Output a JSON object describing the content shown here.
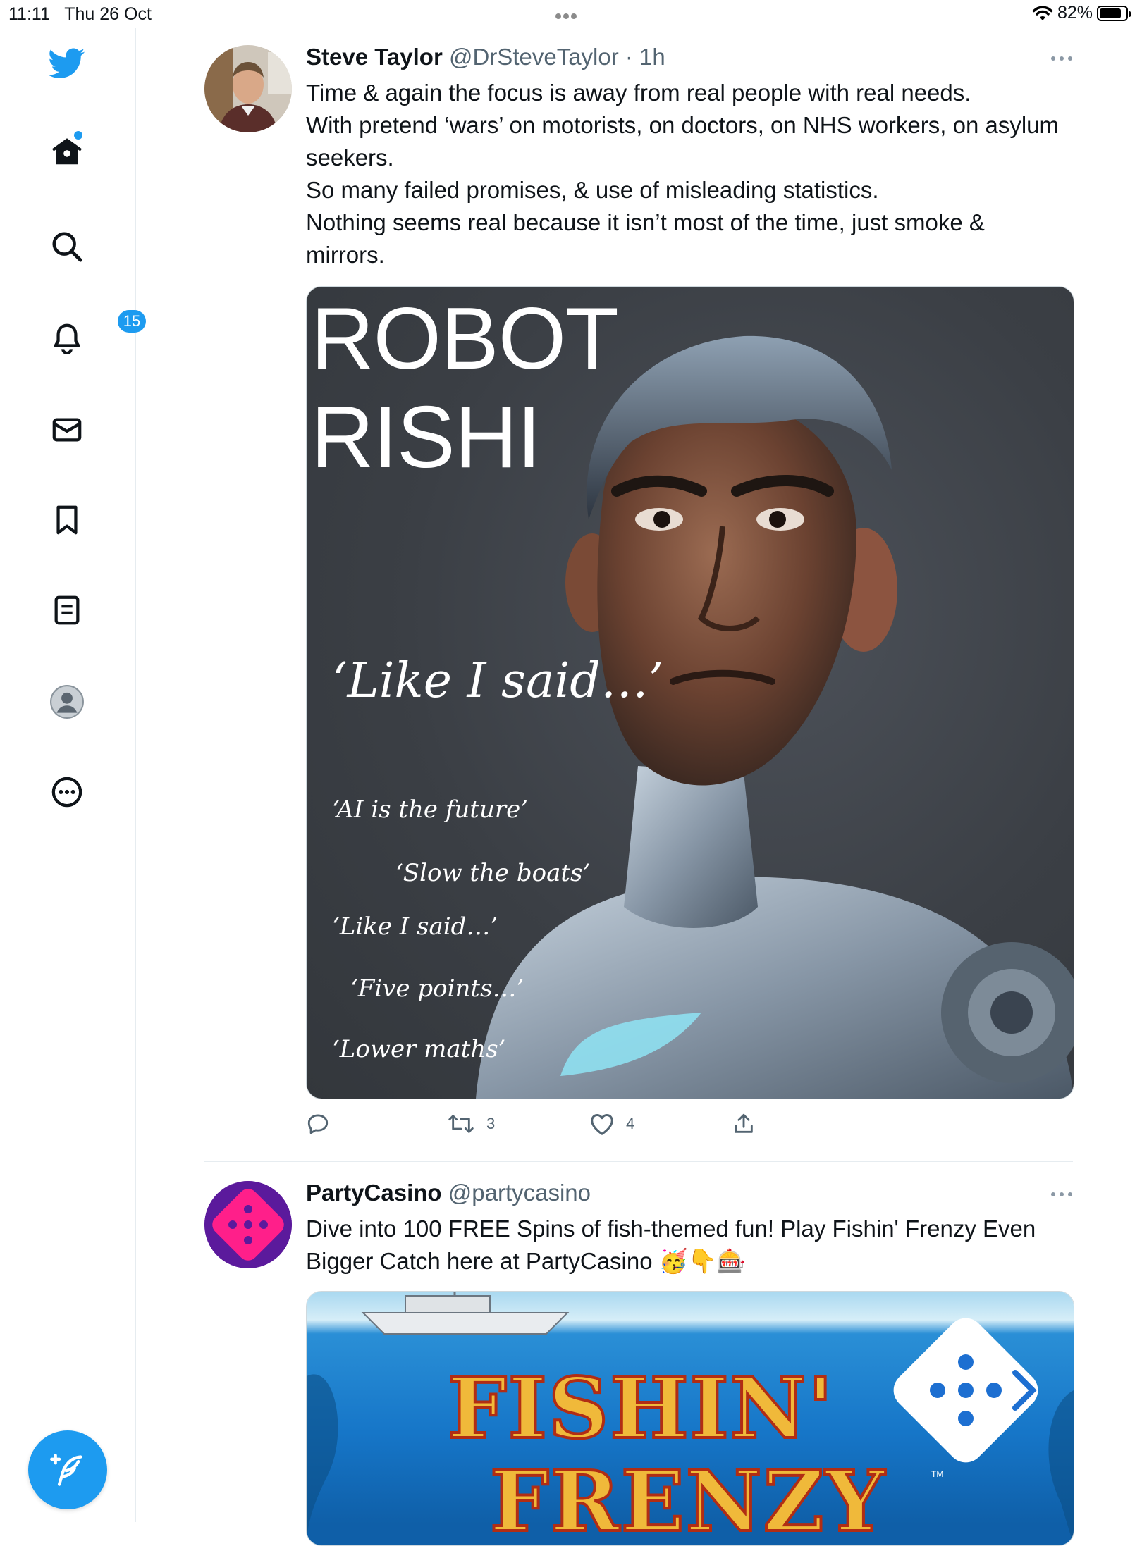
{
  "status_bar": {
    "time": "11:11",
    "date": "Thu 26 Oct",
    "battery": "82%",
    "battery_level": 0.82
  },
  "sidebar": {
    "items": [
      {
        "name": "twitter-logo"
      },
      {
        "name": "home",
        "has_unread": true
      },
      {
        "name": "search"
      },
      {
        "name": "notifications",
        "badge": "15"
      },
      {
        "name": "messages"
      },
      {
        "name": "bookmarks"
      },
      {
        "name": "lists"
      },
      {
        "name": "profile"
      },
      {
        "name": "more"
      }
    ],
    "compose": "compose-tweet"
  },
  "colors": {
    "accent": "#1d9bf0",
    "text": "#0f1419",
    "secondary": "#536471",
    "divider": "#e6ecf0"
  },
  "tweets": [
    {
      "name": "Steve Taylor",
      "handle": "@DrSteveTaylor",
      "time": " · 1h",
      "lines": [
        "Time & again the focus is away from real people with real needs.",
        "With pretend ‘wars’ on motorists, on doctors, on NHS workers, on asylum seekers.",
        "So many failed promises, & use of misleading statistics.",
        "Nothing seems real because it isn’t most of the time, just smoke & mirrors."
      ],
      "image": {
        "title_line1": "ROBOT",
        "title_line2": "RISHI",
        "quote_main": "‘Like I said…’",
        "quotes": [
          "‘AI is the future’",
          "‘Slow the boats’",
          "‘Like I said…’",
          "‘Five points…’",
          "‘Lower maths’"
        ]
      },
      "retweets": "3",
      "likes": "4"
    },
    {
      "name": "PartyCasino",
      "handle": "@partycasino",
      "time": "",
      "text": "Dive into 100 FREE Spins of fish-themed fun! Play Fishin' Frenzy Even Bigger Catch here at PartyCasino 🥳👇🎰",
      "image": {
        "title_line1": "FISHIN'",
        "title_line2": "FRENZY",
        "tm": "TM"
      }
    }
  ]
}
